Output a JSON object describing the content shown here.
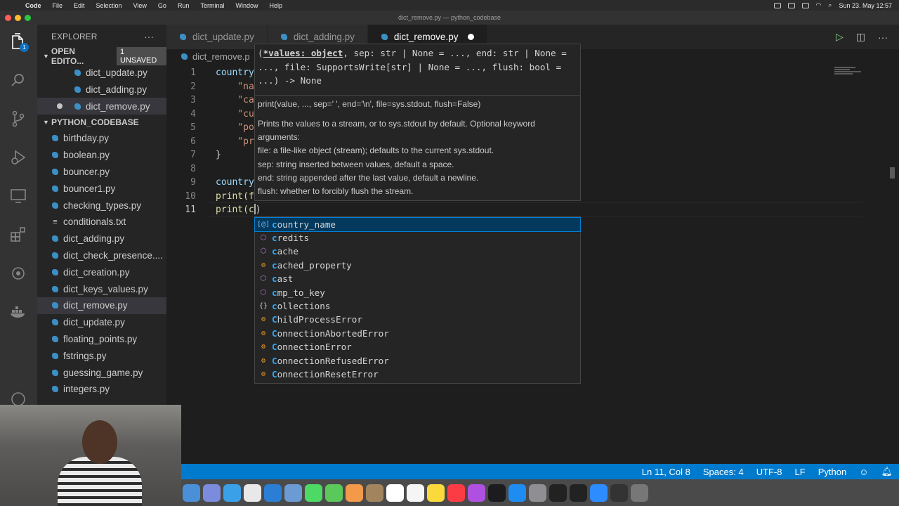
{
  "menubar": {
    "apple": "",
    "items": [
      "Code",
      "File",
      "Edit",
      "Selection",
      "View",
      "Go",
      "Run",
      "Terminal",
      "Window",
      "Help"
    ],
    "clock": "Sun 23. May 12:57"
  },
  "window": {
    "title": "dict_remove.py — python_codebase"
  },
  "activity": {
    "explorer_badge": "1"
  },
  "explorer": {
    "title": "EXPLORER",
    "more": "···",
    "open_editors": {
      "label": "OPEN EDITO...",
      "unsaved": "1 UNSAVED",
      "items": [
        {
          "name": "dict_update.py"
        },
        {
          "name": "dict_adding.py"
        },
        {
          "name": "dict_remove.py"
        }
      ]
    },
    "folder": {
      "label": "PYTHON_CODEBASE",
      "files": [
        "birthday.py",
        "boolean.py",
        "bouncer.py",
        "bouncer1.py",
        "checking_types.py",
        "conditionals.txt",
        "dict_adding.py",
        "dict_check_presence....",
        "dict_creation.py",
        "dict_keys_values.py",
        "dict_remove.py",
        "dict_update.py",
        "floating_points.py",
        "fstrings.py",
        "guessing_game.py",
        "integers.py"
      ]
    }
  },
  "tabs": [
    {
      "label": "dict_update.py"
    },
    {
      "label": "dict_adding.py"
    },
    {
      "label": "dict_remove.py"
    }
  ],
  "breadcrumb": "dict_remove.p",
  "editor": {
    "line_numbers": [
      "1",
      "2",
      "3",
      "4",
      "5",
      "6",
      "7",
      "8",
      "9",
      "10",
      "11"
    ],
    "lines": [
      "country",
      "    \"na",
      "    \"ca",
      "    \"cu",
      "    \"po",
      "    \"pr",
      "}",
      "",
      "country",
      "print(f",
      "print(c"
    ],
    "line11_close": ")"
  },
  "hover": {
    "sig_param": "*values: object",
    "sig_rest1": ", sep: str | None = ..., end: str | None =",
    "sig_line2": "..., file: SupportsWrite[str] | None = ..., flush: bool =",
    "sig_line3": "...) -> None",
    "doc_lines": [
      "print(value, ..., sep=' ', end='\\n', file=sys.stdout, flush=False)",
      "Prints the values to a stream, or to sys.stdout by default. Optional keyword",
      "arguments:",
      "file: a file-like object (stream); defaults to the current sys.stdout.",
      "sep: string inserted between values, default a space.",
      "end: string appended after the last value, default a newline.",
      "flush: whether to forcibly flush the stream."
    ]
  },
  "suggestions": [
    {
      "match": "c",
      "rest": "ountry_name",
      "kind": "variable",
      "icon": "[@]"
    },
    {
      "match": "c",
      "rest": "redits",
      "kind": "module",
      "icon": "⬡"
    },
    {
      "match": "c",
      "rest": "ache",
      "kind": "module",
      "icon": "⬡"
    },
    {
      "match": "c",
      "rest": "ached_property",
      "kind": "class",
      "icon": "⚙"
    },
    {
      "match": "c",
      "rest": "ast",
      "kind": "module",
      "icon": "⬡"
    },
    {
      "match": "c",
      "rest": "mp_to_key",
      "kind": "module",
      "icon": "⬡"
    },
    {
      "match": "c",
      "rest": "ollections",
      "kind": "namespace",
      "icon": "{}"
    },
    {
      "match": "C",
      "rest": "hildProcessError",
      "kind": "class",
      "icon": "⚙"
    },
    {
      "match": "C",
      "rest": "onnectionAbortedError",
      "kind": "class",
      "icon": "⚙"
    },
    {
      "match": "C",
      "rest": "onnectionError",
      "kind": "class",
      "icon": "⚙"
    },
    {
      "match": "C",
      "rest": "onnectionRefusedError",
      "kind": "class",
      "icon": "⚙"
    },
    {
      "match": "C",
      "rest": "onnectionResetError",
      "kind": "class",
      "icon": "⚙"
    }
  ],
  "status": {
    "position": "Ln 11, Col 8",
    "spaces": "Spaces: 4",
    "encoding": "UTF-8",
    "eol": "LF",
    "language": "Python"
  },
  "dock_colors": [
    "#4a90d9",
    "#7b8cde",
    "#3aa0e8",
    "#e8e8e8",
    "#2a7fd4",
    "#6c9bd4",
    "#4cd964",
    "#5ac85a",
    "#f2994a",
    "#a2845e",
    "#ffffff",
    "#f5f5f5",
    "#fbd93c",
    "#fc3c44",
    "#b050e0",
    "#1c1c1e",
    "#1e8cf0",
    "#8e8e93",
    "#222222",
    "#222222",
    "#2d8cff",
    "#333333",
    "#777777"
  ],
  "colors": {
    "accent": "#007acc",
    "selection": "#04395e",
    "match": "#2aaaff"
  }
}
